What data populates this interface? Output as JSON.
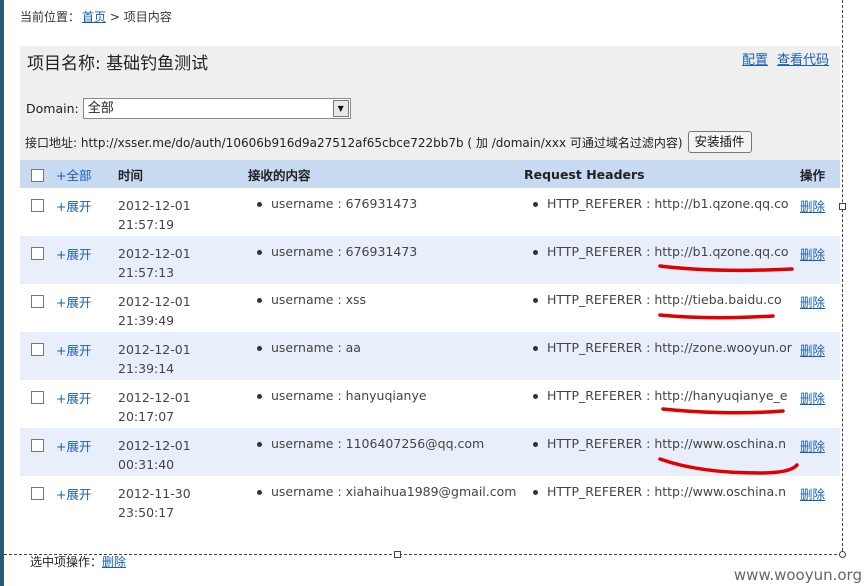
{
  "breadcrumb": {
    "prefix": "当前位置：",
    "home": "首页",
    "separator": " > ",
    "current": "项目内容"
  },
  "project": {
    "title": "项目名称: 基础钓鱼测试",
    "links": [
      "配置",
      "查看代码"
    ]
  },
  "domain": {
    "label": "Domain:",
    "value": "全部"
  },
  "api": {
    "text": "接口地址: http://xsser.me/do/auth/10606b916d9a27512af65cbce722bb7b ( 加 /domain/xxx 可通过域名过滤内容)",
    "install_button": "安装插件"
  },
  "table": {
    "headers": {
      "all": "+全部",
      "time": "时间",
      "content": "接收的内容",
      "headers": "Request Headers",
      "action": "操作"
    },
    "rows": [
      {
        "expand": "+展开",
        "date": "2012-12-01",
        "time": "21:57:19",
        "content": "username : 676931473",
        "header": "HTTP_REFERER : http://b1.qzone.qq.co",
        "action": "删除"
      },
      {
        "expand": "+展开",
        "date": "2012-12-01",
        "time": "21:57:13",
        "content": "username : 676931473",
        "header": "HTTP_REFERER : http://b1.qzone.qq.co",
        "action": "删除"
      },
      {
        "expand": "+展开",
        "date": "2012-12-01",
        "time": "21:39:49",
        "content": "username : xss",
        "header": "HTTP_REFERER : http://tieba.baidu.co",
        "action": "删除"
      },
      {
        "expand": "+展开",
        "date": "2012-12-01",
        "time": "21:39:14",
        "content": "username : aa",
        "header": "HTTP_REFERER : http://zone.wooyun.or",
        "action": "删除"
      },
      {
        "expand": "+展开",
        "date": "2012-12-01",
        "time": "20:17:07",
        "content": "username : hanyuqianye",
        "header": "HTTP_REFERER : http://hanyuqianye_e",
        "action": "删除"
      },
      {
        "expand": "+展开",
        "date": "2012-12-01",
        "time": "00:31:40",
        "content": "username : 1106407256@qq.com",
        "header": "HTTP_REFERER : http://www.oschina.n",
        "action": "删除"
      },
      {
        "expand": "+展开",
        "date": "2012-11-30",
        "time": "23:50:17",
        "content": "username : xiahaihua1989@gmail.com",
        "header": "HTTP_REFERER : http://www.oschina.n",
        "action": "删除"
      }
    ]
  },
  "bottom": {
    "label": "选中项操作：",
    "delete": "删除"
  },
  "watermark": "www.wooyun.org",
  "colors": {
    "header_bg": "#c7daf1",
    "alt_row_bg": "#e8effa",
    "panel_bg": "#efefef",
    "link": "#1a5fb4",
    "annotation": "#e00000"
  }
}
